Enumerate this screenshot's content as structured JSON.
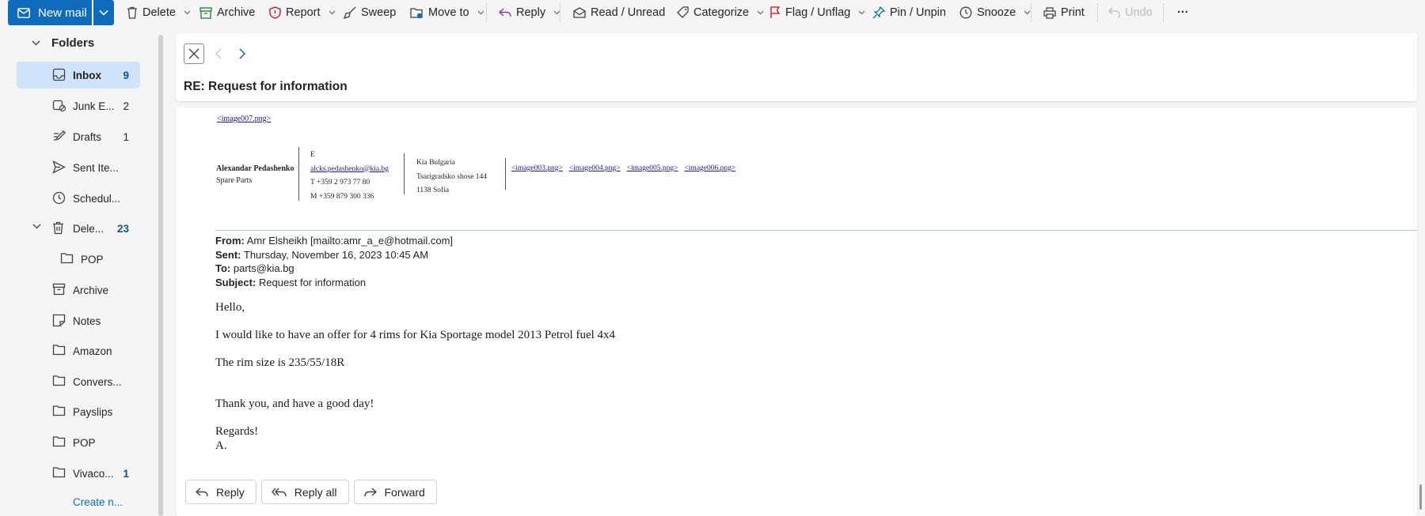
{
  "toolbar": {
    "new_mail": "New mail",
    "delete": "Delete",
    "archive": "Archive",
    "report": "Report",
    "sweep": "Sweep",
    "move_to": "Move to",
    "reply": "Reply",
    "read_unread": "Read / Unread",
    "categorize": "Categorize",
    "flag_unflag": "Flag / Unflag",
    "pin_unpin": "Pin / Unpin",
    "snooze": "Snooze",
    "print": "Print",
    "undo": "Undo",
    "more": "···"
  },
  "sidebar": {
    "header": "Folders",
    "items": [
      {
        "label": "Inbox",
        "count": "9",
        "icon": "inbox-icon"
      },
      {
        "label": "Junk E...",
        "count": "2",
        "icon": "junk-icon"
      },
      {
        "label": "Drafts",
        "count": "1",
        "icon": "drafts-icon"
      },
      {
        "label": "Sent Ite...",
        "count": "",
        "icon": "send-icon"
      },
      {
        "label": "Schedul...",
        "count": "",
        "icon": "clock-icon"
      },
      {
        "label": "Dele...",
        "count": "23",
        "icon": "trash-icon"
      },
      {
        "label": "POP",
        "count": "",
        "icon": "folder-icon"
      },
      {
        "label": "Archive",
        "count": "",
        "icon": "archive-icon"
      },
      {
        "label": "Notes",
        "count": "",
        "icon": "notes-icon"
      },
      {
        "label": "Amazon",
        "count": "",
        "icon": "folder-icon"
      },
      {
        "label": "Convers...",
        "count": "",
        "icon": "folder-icon"
      },
      {
        "label": "Payslips",
        "count": "",
        "icon": "folder-icon"
      },
      {
        "label": "POP",
        "count": "",
        "icon": "folder-icon"
      },
      {
        "label": "Vivaco...",
        "count": "1",
        "icon": "folder-icon"
      }
    ],
    "create_new": "Create n..."
  },
  "reading": {
    "subject": "RE: Request for information"
  },
  "message": {
    "image007": "<image007.png>",
    "signature": {
      "name": "Alexandar Pedashenko",
      "role": "Spare Parts",
      "e_label": "E",
      "email": "alcks.pedashenko@kia.bg",
      "phone_t": "T +359 2 973 77 80",
      "phone_m": "M +359 879 300 336",
      "company": "Kia Bulgaria",
      "street": "Tsarigradsko shose 144",
      "city": "1138 Sofia",
      "images": [
        "<image003.png>",
        "<image004.png>",
        "<image005.png>",
        "<image006.png>"
      ]
    },
    "headers": {
      "from_label": "From:",
      "from": "Amr Elsheikh [mailto:amr_a_e@hotmail.com]",
      "sent_label": "Sent:",
      "sent": "Thursday, November 16, 2023 10:45 AM",
      "to_label": "To:",
      "to": "parts@kia.bg",
      "subject_label": "Subject:",
      "subject": "Request for information"
    },
    "body": {
      "greeting": "Hello,",
      "line1": "I would like to have an offer for 4 rims for Kia Sportage model 2013 Petrol fuel 4x4",
      "line2": "The rim size is 235/55/18R",
      "line3": "Thank you, and have a good day!",
      "regards": "Regards!",
      "initial": "A."
    },
    "actions": {
      "reply": "Reply",
      "reply_all": "Reply all",
      "forward": "Forward"
    }
  },
  "colors": {
    "accent": "#0f6cbd",
    "selected_bg": "#cfe4fa",
    "count_blue": "#0f548c"
  }
}
